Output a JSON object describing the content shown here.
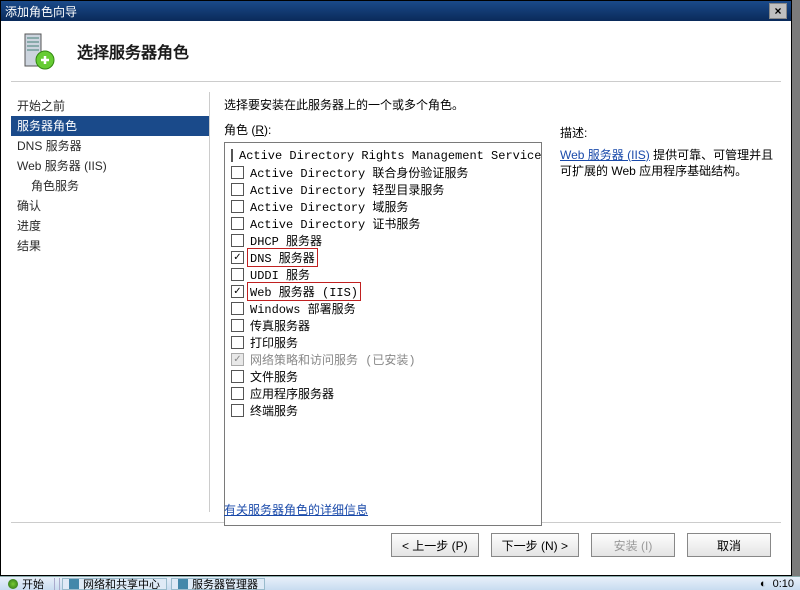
{
  "titlebar": {
    "title": "添加角色向导"
  },
  "header": {
    "title": "选择服务器角色"
  },
  "sidebar": {
    "items": [
      {
        "label": "开始之前",
        "selected": false,
        "indent": false
      },
      {
        "label": "服务器角色",
        "selected": true,
        "indent": false
      },
      {
        "label": "DNS 服务器",
        "selected": false,
        "indent": false
      },
      {
        "label": "Web 服务器 (IIS)",
        "selected": false,
        "indent": false
      },
      {
        "label": "角色服务",
        "selected": false,
        "indent": true
      },
      {
        "label": "确认",
        "selected": false,
        "indent": false
      },
      {
        "label": "进度",
        "selected": false,
        "indent": false
      },
      {
        "label": "结果",
        "selected": false,
        "indent": false
      }
    ]
  },
  "main": {
    "instruction": "选择要安装在此服务器上的一个或多个角色。",
    "roles_label_prefix": "角色 (",
    "roles_label_key": "R",
    "roles_label_suffix": "):",
    "roles": [
      {
        "label": "Active Directory Rights Management Services",
        "checked": false,
        "highlighted": false
      },
      {
        "label": "Active Directory 联合身份验证服务",
        "checked": false,
        "highlighted": false
      },
      {
        "label": "Active Directory 轻型目录服务",
        "checked": false,
        "highlighted": false
      },
      {
        "label": "Active Directory 域服务",
        "checked": false,
        "highlighted": false
      },
      {
        "label": "Active Directory 证书服务",
        "checked": false,
        "highlighted": false
      },
      {
        "label": "DHCP 服务器",
        "checked": false,
        "highlighted": false
      },
      {
        "label": "DNS 服务器",
        "checked": true,
        "highlighted": true
      },
      {
        "label": "UDDI 服务",
        "checked": false,
        "highlighted": false
      },
      {
        "label": "Web 服务器 (IIS)",
        "checked": true,
        "highlighted": true
      },
      {
        "label": "Windows 部署服务",
        "checked": false,
        "highlighted": false
      },
      {
        "label": "传真服务器",
        "checked": false,
        "highlighted": false
      },
      {
        "label": "打印服务",
        "checked": false,
        "highlighted": false
      },
      {
        "label": "网络策略和访问服务   (已安装)",
        "checked": true,
        "highlighted": false,
        "disabled": true
      },
      {
        "label": "文件服务",
        "checked": false,
        "highlighted": false
      },
      {
        "label": "应用程序服务器",
        "checked": false,
        "highlighted": false
      },
      {
        "label": "终端服务",
        "checked": false,
        "highlighted": false
      }
    ],
    "info_link": "有关服务器角色的详细信息"
  },
  "desc": {
    "title": "描述:",
    "link_text": "Web 服务器 (IIS)",
    "rest": " 提供可靠、可管理并且可扩展的 Web 应用程序基础结构。"
  },
  "footer": {
    "back": "< 上一步 (P)",
    "next": "下一步 (N) >",
    "install": "安装 (I)",
    "cancel": "取消"
  },
  "taskbar": {
    "start": "开始",
    "items": [
      "网络和共享中心",
      "服务器管理器"
    ],
    "time": "0:10"
  }
}
